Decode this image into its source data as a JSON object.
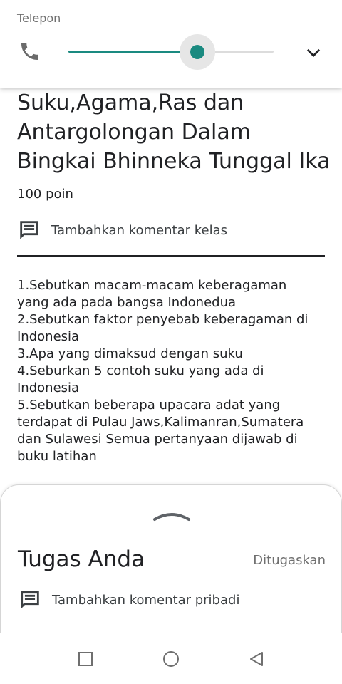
{
  "volume": {
    "label": "Telepon",
    "level": 0.63,
    "accent": "#1a8a80",
    "icon": "phone-icon",
    "expand_icon": "chevron-down-icon"
  },
  "assignment": {
    "title_lines": [
      "Suku,Agama,Ras dan",
      "Antargolongan Dalam",
      "Bingkai Bhinneka Tunggal Ika"
    ],
    "points": "100 poin",
    "class_comment": "Tambahkan komentar kelas",
    "description_lines": [
      "1.Sebutkan macam-macam keberagaman",
      "yang ada pada bangsa Indonedua",
      "2.Sebutkan faktor penyebab keberagaman di",
      "Indonesia",
      "3.Apa yang dimaksud dengan suku",
      "4.Seburkan 5 contoh suku yang ada di",
      "Indonesia",
      "5.Sebutkan beberapa upacara adat yang",
      "terdapat di Pulau Jaws,Kalimanran,Sumatera",
      "dan Sulawesi Semua pertanyaan dijawab di",
      "buku latihan"
    ]
  },
  "sheet": {
    "title": "Tugas Anda",
    "status": "Ditugaskan",
    "private_comment": "Tambahkan komentar pribadi"
  },
  "navbar": {
    "icons": [
      "recent-apps-icon",
      "home-icon",
      "back-icon"
    ]
  }
}
